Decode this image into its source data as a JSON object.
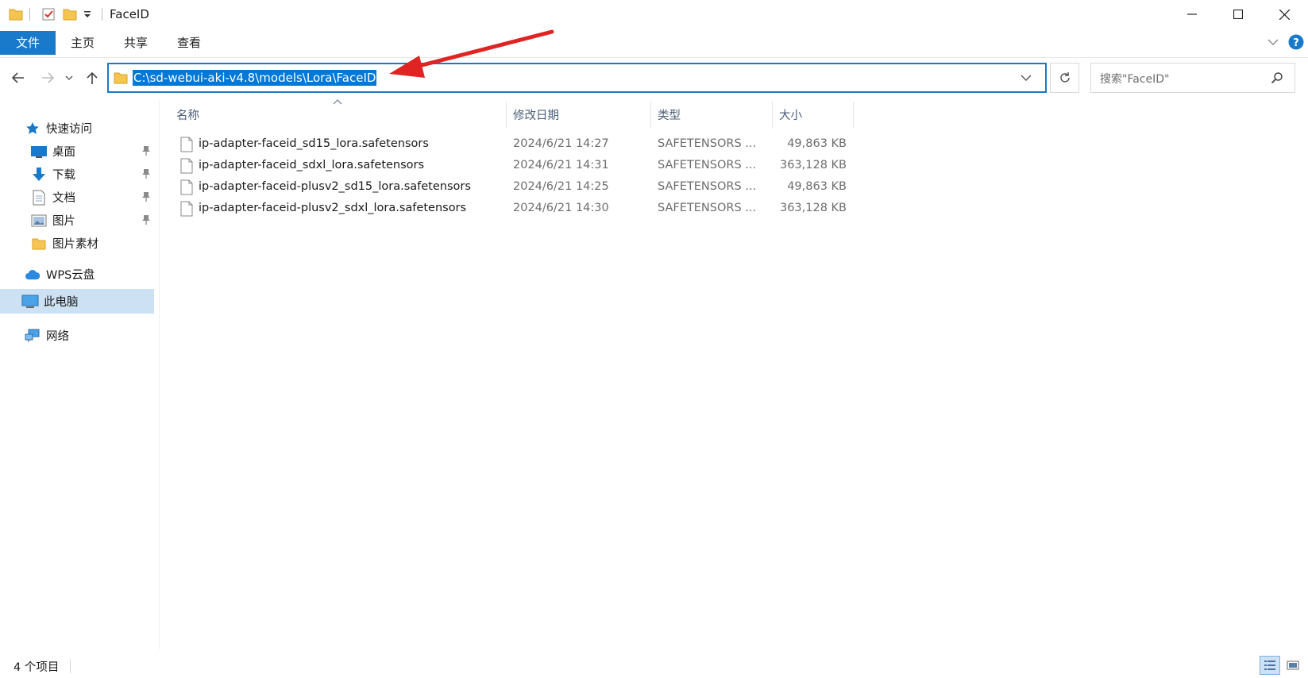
{
  "window": {
    "title": "FaceID",
    "minimize_label": "—",
    "maximize_label": "☐",
    "close_label": "✕"
  },
  "ribbon": {
    "tabs": [
      {
        "label": "文件"
      },
      {
        "label": "主页"
      },
      {
        "label": "共享"
      },
      {
        "label": "查看"
      }
    ],
    "help_label": "?"
  },
  "address": {
    "path": "C:\\sd-webui-aki-v4.8\\models\\Lora\\FaceID",
    "search_placeholder": "搜索\"FaceID\""
  },
  "sidebar": {
    "quick_access": "快速访问",
    "items": [
      {
        "label": "桌面",
        "pinned": true
      },
      {
        "label": "下载",
        "pinned": true
      },
      {
        "label": "文档",
        "pinned": true
      },
      {
        "label": "图片",
        "pinned": true
      },
      {
        "label": "图片素材",
        "pinned": false
      }
    ],
    "wps": "WPS云盘",
    "this_pc": "此电脑",
    "network": "网络"
  },
  "columns": {
    "name": "名称",
    "date": "修改日期",
    "type": "类型",
    "size": "大小"
  },
  "files": [
    {
      "name": "ip-adapter-faceid_sd15_lora.safetensors",
      "date": "2024/6/21 14:27",
      "type": "SAFETENSORS ...",
      "size": "49,863 KB"
    },
    {
      "name": "ip-adapter-faceid_sdxl_lora.safetensors",
      "date": "2024/6/21 14:31",
      "type": "SAFETENSORS ...",
      "size": "363,128 KB"
    },
    {
      "name": "ip-adapter-faceid-plusv2_sd15_lora.safetensors",
      "date": "2024/6/21 14:25",
      "type": "SAFETENSORS ...",
      "size": "49,863 KB"
    },
    {
      "name": "ip-adapter-faceid-plusv2_sdxl_lora.safetensors",
      "date": "2024/6/21 14:30",
      "type": "SAFETENSORS ...",
      "size": "363,128 KB"
    }
  ],
  "status": {
    "count": "4 个项目"
  },
  "colors": {
    "accent": "#1979ca",
    "selection": "#0078d7",
    "folder": "#f5c451",
    "annotation_arrow": "#e02424"
  }
}
